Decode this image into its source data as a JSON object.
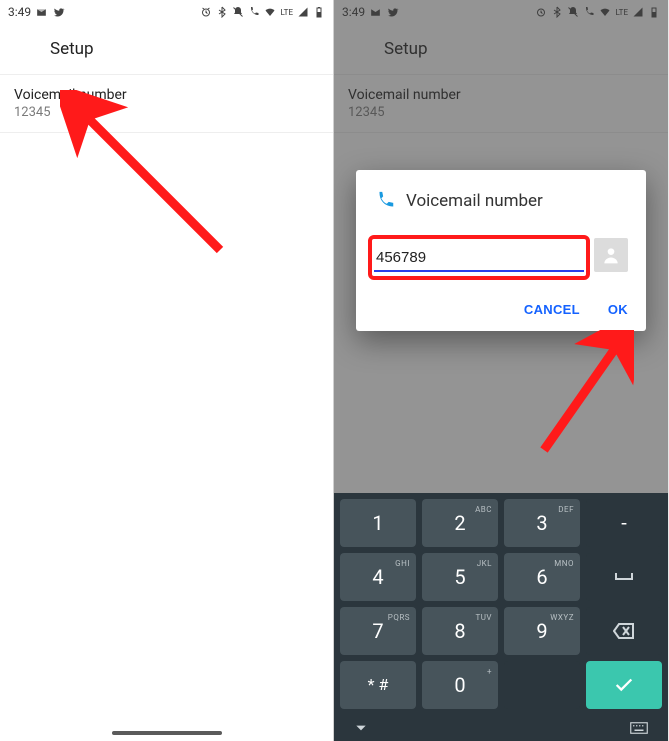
{
  "status": {
    "time": "3:49",
    "lte": "LTE"
  },
  "header": {
    "title": "Setup"
  },
  "voicemail": {
    "label": "Voicemail number",
    "value": "12345"
  },
  "dialog": {
    "title": "Voicemail number",
    "input": "456789",
    "cancel": "CANCEL",
    "ok": "OK"
  },
  "keypad": {
    "k1": {
      "n": "1",
      "s": ""
    },
    "k2": {
      "n": "2",
      "s": "ABC"
    },
    "k3": {
      "n": "3",
      "s": "DEF"
    },
    "k4": {
      "n": "4",
      "s": "GHI"
    },
    "k5": {
      "n": "5",
      "s": "JKL"
    },
    "k6": {
      "n": "6",
      "s": "MNO"
    },
    "k7": {
      "n": "7",
      "s": "PQRS"
    },
    "k8": {
      "n": "8",
      "s": "TUV"
    },
    "k9": {
      "n": "9",
      "s": "WXYZ"
    },
    "kstar": {
      "n": "* #",
      "s": ""
    },
    "k0": {
      "n": "0",
      "s": "+"
    },
    "kdash": {
      "n": "-",
      "s": ""
    }
  }
}
